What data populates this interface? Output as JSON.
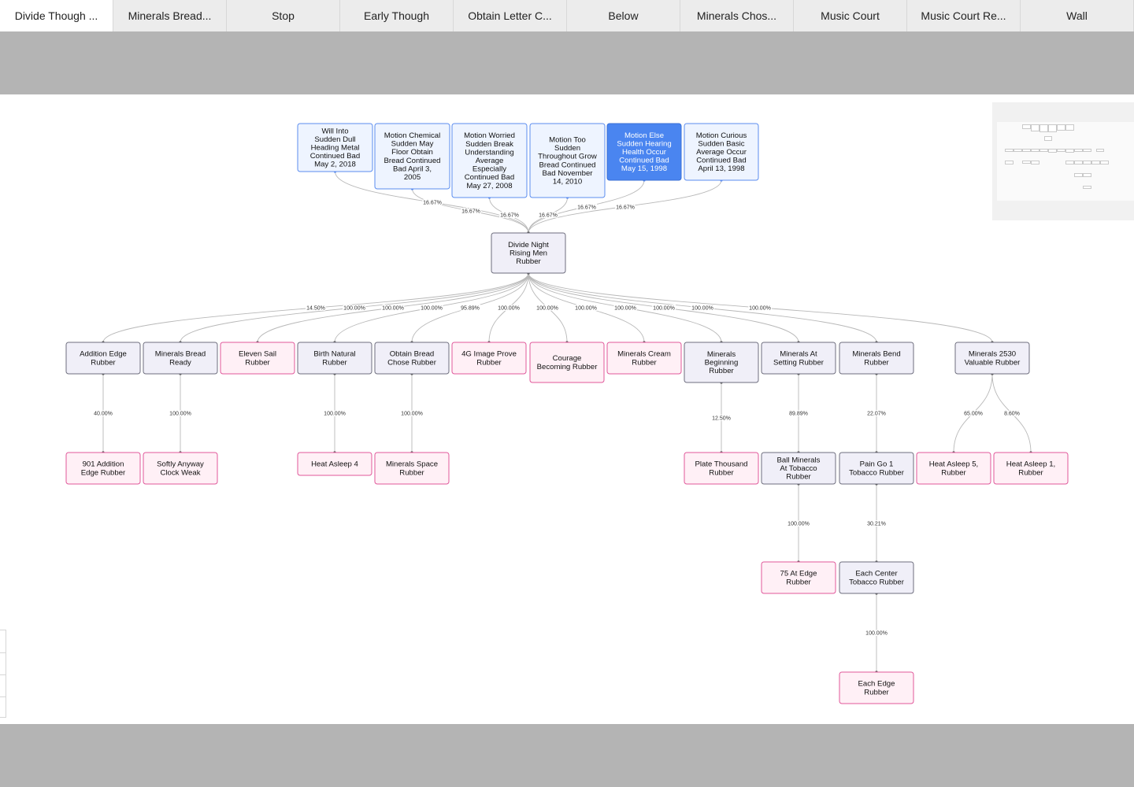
{
  "tabs": [
    {
      "label": "Divide Though ...",
      "active": true
    },
    {
      "label": "Minerals Bread..."
    },
    {
      "label": "Stop"
    },
    {
      "label": "Early Though"
    },
    {
      "label": "Obtain Letter C..."
    },
    {
      "label": "Below"
    },
    {
      "label": "Minerals Chos..."
    },
    {
      "label": "Music Court"
    },
    {
      "label": "Music Court Re..."
    },
    {
      "label": "Wall"
    }
  ],
  "colors": {
    "blue_fill": "#eef4ff",
    "blue_stroke": "#5b8def",
    "selected_fill": "#4a85f0",
    "selected_stroke": "#3a6fd6",
    "neutral_fill": "#f0eff8",
    "neutral_stroke": "#6e6e7e",
    "pink_fill": "#fff0f6",
    "pink_stroke": "#e0579a",
    "edge": "#b8b8b8",
    "band": "#b4b4b4"
  },
  "diagram": {
    "nodes": [
      {
        "id": "p1",
        "style": "blue",
        "label": "Will Into Sudden Dull Heading Metal Continued Bad May 2, 2018"
      },
      {
        "id": "p2",
        "style": "blue",
        "label": "Motion Chemical Sudden May Floor Obtain Bread Continued Bad April 3, 2005"
      },
      {
        "id": "p3",
        "style": "blue",
        "label": "Motion Worried Sudden Break Understanding Average Especially Continued Bad May 27, 2008"
      },
      {
        "id": "p4",
        "style": "blue",
        "label": "Motion Too Sudden Throughout Grow Bread Continued Bad November 14, 2010"
      },
      {
        "id": "p5",
        "style": "selected",
        "label": "Motion Else Sudden Hearing Health Occur Continued Bad May 15, 1998"
      },
      {
        "id": "p6",
        "style": "blue",
        "label": "Motion Curious Sudden Basic Average Occur Continued Bad April 13, 1998"
      },
      {
        "id": "root",
        "style": "neutral",
        "label": "Divide Night Rising Men Rubber"
      },
      {
        "id": "c1",
        "style": "neutral",
        "label": "Addition Edge Rubber"
      },
      {
        "id": "c2",
        "style": "neutral",
        "label": "Minerals Bread Ready"
      },
      {
        "id": "c3",
        "style": "pink",
        "label": "Eleven Sail Rubber"
      },
      {
        "id": "c4",
        "style": "neutral",
        "label": "Birth Natural Rubber"
      },
      {
        "id": "c5",
        "style": "neutral",
        "label": "Obtain Bread Chose Rubber"
      },
      {
        "id": "c6",
        "style": "pink",
        "label": "4G Image Prove Rubber"
      },
      {
        "id": "c7",
        "style": "pink",
        "label": "Courage Becoming Rubber"
      },
      {
        "id": "c8",
        "style": "pink",
        "label": "Minerals Cream Rubber"
      },
      {
        "id": "c9",
        "style": "neutral",
        "label": "Minerals Beginning Rubber"
      },
      {
        "id": "c10",
        "style": "neutral",
        "label": "Minerals At Setting Rubber"
      },
      {
        "id": "c11",
        "style": "neutral",
        "label": "Minerals Bend Rubber"
      },
      {
        "id": "c12",
        "style": "neutral",
        "label": "Minerals 2530 Valuable Rubber"
      },
      {
        "id": "g1",
        "style": "pink",
        "label": "901 Addition Edge Rubber"
      },
      {
        "id": "g2",
        "style": "pink",
        "label": "Softly Anyway Clock Weak"
      },
      {
        "id": "g3",
        "style": "pink",
        "label": "Heat Asleep 4"
      },
      {
        "id": "g4",
        "style": "pink",
        "label": "Minerals Space Rubber"
      },
      {
        "id": "g5",
        "style": "pink",
        "label": "Plate Thousand Rubber"
      },
      {
        "id": "g6",
        "style": "neutral",
        "label": "Ball Minerals At Tobacco Rubber"
      },
      {
        "id": "g7",
        "style": "neutral",
        "label": "Pain Go 1 Tobacco Rubber"
      },
      {
        "id": "g8",
        "style": "pink",
        "label": "Heat Asleep 5, Rubber"
      },
      {
        "id": "g9",
        "style": "pink",
        "label": "Heat Asleep 1, Rubber"
      },
      {
        "id": "h1",
        "style": "pink",
        "label": "75 At Edge Rubber"
      },
      {
        "id": "h2",
        "style": "neutral",
        "label": "Each Center Tobacco Rubber"
      },
      {
        "id": "i1",
        "style": "pink",
        "label": "Each Edge Rubber"
      }
    ],
    "edges": [
      {
        "from": "p1",
        "to": "root",
        "label": "16.67%"
      },
      {
        "from": "p2",
        "to": "root",
        "label": "16.67%"
      },
      {
        "from": "p3",
        "to": "root",
        "label": "16.67%"
      },
      {
        "from": "p4",
        "to": "root",
        "label": "16.67%"
      },
      {
        "from": "p5",
        "to": "root",
        "label": "16.67%"
      },
      {
        "from": "p6",
        "to": "root",
        "label": "16.67%"
      },
      {
        "from": "root",
        "to": "c1",
        "label": "14.50%"
      },
      {
        "from": "root",
        "to": "c2",
        "label": "100.00%"
      },
      {
        "from": "root",
        "to": "c3",
        "label": "100.00%"
      },
      {
        "from": "root",
        "to": "c4",
        "label": "100.00%"
      },
      {
        "from": "root",
        "to": "c5",
        "label": "95.89%"
      },
      {
        "from": "root",
        "to": "c6",
        "label": "100.00%"
      },
      {
        "from": "root",
        "to": "c7",
        "label": "100.00%"
      },
      {
        "from": "root",
        "to": "c8",
        "label": "100.00%"
      },
      {
        "from": "root",
        "to": "c9",
        "label": "100.00%"
      },
      {
        "from": "root",
        "to": "c10",
        "label": "100.00%"
      },
      {
        "from": "root",
        "to": "c11",
        "label": "100.00%"
      },
      {
        "from": "root",
        "to": "c12",
        "label": "100.00%"
      },
      {
        "from": "c1",
        "to": "g1",
        "label": "40.00%"
      },
      {
        "from": "c2",
        "to": "g2",
        "label": "100.00%"
      },
      {
        "from": "c4",
        "to": "g3",
        "label": "100.00%"
      },
      {
        "from": "c5",
        "to": "g4",
        "label": "100.00%"
      },
      {
        "from": "c9",
        "to": "g5",
        "label": "12.50%"
      },
      {
        "from": "c10",
        "to": "g6",
        "label": "89.89%"
      },
      {
        "from": "c11",
        "to": "g7",
        "label": "22.07%"
      },
      {
        "from": "c12",
        "to": "g8",
        "label": "65.00%"
      },
      {
        "from": "c12",
        "to": "g9",
        "label": "8.60%"
      },
      {
        "from": "g6",
        "to": "h1",
        "label": "100.00%"
      },
      {
        "from": "g7",
        "to": "h2",
        "label": "30.21%"
      },
      {
        "from": "h2",
        "to": "i1",
        "label": "100.00%"
      }
    ]
  }
}
